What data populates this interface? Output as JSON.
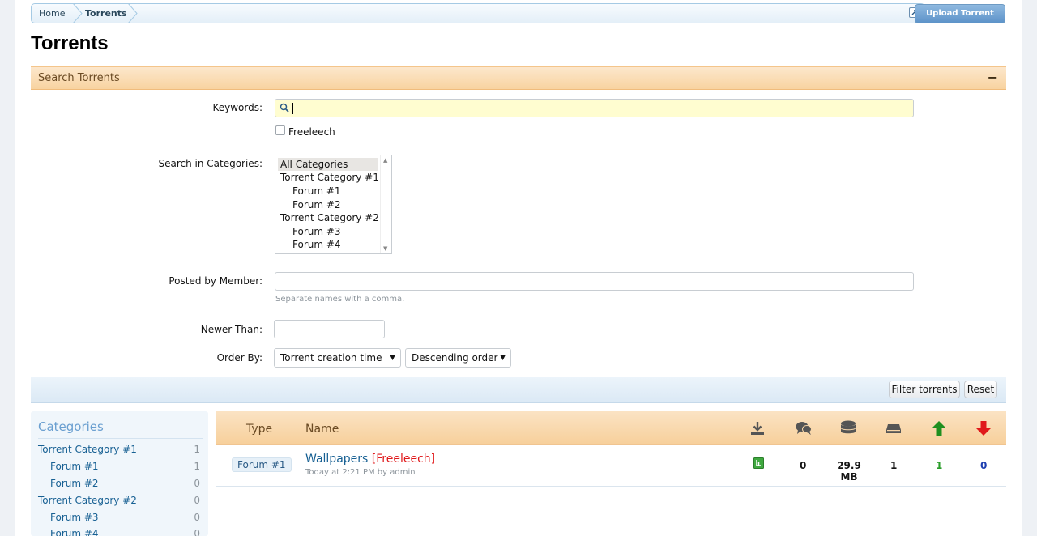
{
  "breadcrumb": {
    "home": "Home",
    "current": "Torrents"
  },
  "header": {
    "upload_label": "Upload Torrent",
    "page_title": "Torrents"
  },
  "search": {
    "section_title": "Search Torrents",
    "collapse_symbol": "−",
    "keywords_label": "Keywords:",
    "keywords_value": "",
    "freeleech_label": "Freeleech",
    "freeleech_checked": false,
    "categories_label": "Search in Categories:",
    "categories": [
      {
        "label": "All Categories",
        "selected": true
      },
      {
        "label": "Torrent Category #1"
      },
      {
        "label": "Forum #1"
      },
      {
        "label": "Forum #2"
      },
      {
        "label": "Torrent Category #2"
      },
      {
        "label": "Forum #3"
      },
      {
        "label": "Forum #4"
      }
    ],
    "member_label": "Posted by Member:",
    "member_hint": "Separate names with a comma.",
    "newer_label": "Newer Than:",
    "order_label": "Order By:",
    "order_field": "Torrent creation time",
    "order_direction": "Descending order",
    "filter_button": "Filter torrents",
    "reset_button": "Reset"
  },
  "sidebar": {
    "title": "Categories",
    "items": [
      {
        "name": "Torrent Category #1",
        "count": "1"
      },
      {
        "name": "Forum #1",
        "count": "1"
      },
      {
        "name": "Forum #2",
        "count": "0"
      },
      {
        "name": "Torrent Category #2",
        "count": "0"
      },
      {
        "name": "Forum #3",
        "count": "0"
      },
      {
        "name": "Forum #4",
        "count": "0"
      }
    ]
  },
  "table": {
    "col_type": "Type",
    "col_name": "Name",
    "icons": [
      "download-icon",
      "comments-icon",
      "size-icon",
      "completed-icon",
      "seeders-icon",
      "leechers-icon"
    ],
    "rows": [
      {
        "type": "Forum #1",
        "name": "Wallpapers",
        "tag": "[Freeleech]",
        "meta": "Today at 2:21 PM by admin",
        "comments": "0",
        "size": "29.9 MB",
        "completed": "1",
        "seeders": "1",
        "leechers": "0"
      }
    ]
  },
  "colors": {
    "seeders": "#2a9d2a",
    "leechers": "#1e3fb0",
    "freeleech": "#e0191b",
    "accent": "#f7d09c"
  }
}
